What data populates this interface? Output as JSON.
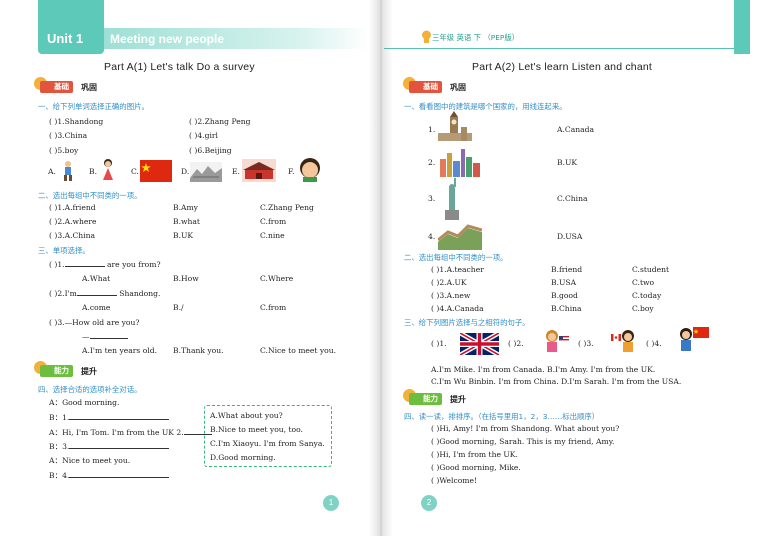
{
  "left": {
    "header": {
      "unit": "Unit 1",
      "subtitle": "Meeting new people"
    },
    "title": "Part A(1)   Let's talk   Do a survey",
    "badges": {
      "basic_label": "基础",
      "basic_tail": "巩固",
      "ability_label": "能力",
      "ability_tail": "提升"
    },
    "q1": {
      "heading": "一、给下列单词选择正确的图片。",
      "items": [
        [
          "(      )1.Shandong",
          "(      )2.Zhang Peng"
        ],
        [
          "(      )3.China",
          "(      )4.girl"
        ],
        [
          "(      )5.boy",
          "(      )6.Beijing"
        ]
      ],
      "pic_letters": [
        "A.",
        "B.",
        "C.",
        "D.",
        "E.",
        "F."
      ]
    },
    "q2": {
      "heading": "二、选出每组中不同类的一项。",
      "rows": [
        [
          "(      )1.A.friend",
          "B.Amy",
          "C.Zhang Peng"
        ],
        [
          "(      )2.A.where",
          "B.what",
          "C.from"
        ],
        [
          "(      )3.A.China",
          "B.UK",
          "C.nine"
        ]
      ]
    },
    "q3": {
      "heading": "三、单项选择。",
      "q1_stem_a": "(      )1.",
      "q1_stem_b": " are you from?",
      "q1_opts": [
        "A.What",
        "B.How",
        "C.Where"
      ],
      "q2_stem_a": "(      )2.I'm",
      "q2_stem_b": " Shandong.",
      "q2_opts": [
        "A.come",
        "B./",
        "C.from"
      ],
      "q3_stem": "(      )3.—How old are you?",
      "q3_dash": "—",
      "q3_opts": [
        "A.I'm ten years old.",
        "B.Thank you.",
        "C.Nice to meet you."
      ]
    },
    "q4": {
      "heading": "四、选择合适的选项补全对话。",
      "dialog": [
        "A：Good morning.",
        "B：1.",
        "A：Hi, I'm Tom. I'm from the UK 2.",
        "B：3.",
        "A：Nice to meet you.",
        "B：4."
      ],
      "options": [
        "A.What about you?",
        "B.Nice to meet you, too.",
        "C.I'm Xiaoyu. I'm from Sanya.",
        "D.Good morning."
      ]
    },
    "page_number": "1"
  },
  "right": {
    "header": {
      "grade": "三年级  英语 下 （PEP版）"
    },
    "title": "Part A(2)   Let's learn   Listen and chant",
    "badges": {
      "basic_label": "基础",
      "basic_tail": "巩固",
      "ability_label": "能力",
      "ability_tail": "提升"
    },
    "q1": {
      "heading": "一、看看图中的建筑是哪个国家的，用线连起来。",
      "numbers": [
        "1.",
        "2.",
        "3.",
        "4."
      ],
      "countries": [
        "A.Canada",
        "B.UK",
        "C.China",
        "D.USA"
      ]
    },
    "q2": {
      "heading": "二、选出每组中不同类的一项。",
      "rows": [
        [
          "(      )1.A.teacher",
          "B.friend",
          "C.student"
        ],
        [
          "(      )2.A.UK",
          "B.USA",
          "C.two"
        ],
        [
          "(      )3.A.new",
          "B.good",
          "C.today"
        ],
        [
          "(      )4.A.Canada",
          "B.China",
          "C.boy"
        ]
      ]
    },
    "q3": {
      "heading": "三、给下列图片选择与之相符的句子。",
      "blanks": [
        "(      )1.",
        "(      )2.",
        "(      )3.",
        "(      )4."
      ],
      "sentences": [
        "A.I'm Mike. I'm from Canada.     B.I'm Amy. I'm from the UK.",
        "C.I'm Wu Binbin. I'm from China. D.I'm Sarah. I'm from the USA."
      ]
    },
    "q4": {
      "heading": "四、读一读，排排序。（在括号里用1，2，3……标出顺序）",
      "lines": [
        "(      )Hi, Amy! I'm from Shandong. What about you?",
        "(      )Good morning, Sarah. This is my friend, Amy.",
        "(      )Hi, I'm from the UK.",
        "(      )Good morning, Mike.",
        "(      )Welcome!"
      ]
    },
    "page_number": "2"
  },
  "colors": {
    "teal": "#5dc9b9",
    "section_blue": "#2f8fc9",
    "badge_red": "#e2553c",
    "badge_green": "#6cbf3e",
    "dashed_box": "#35b97b"
  }
}
